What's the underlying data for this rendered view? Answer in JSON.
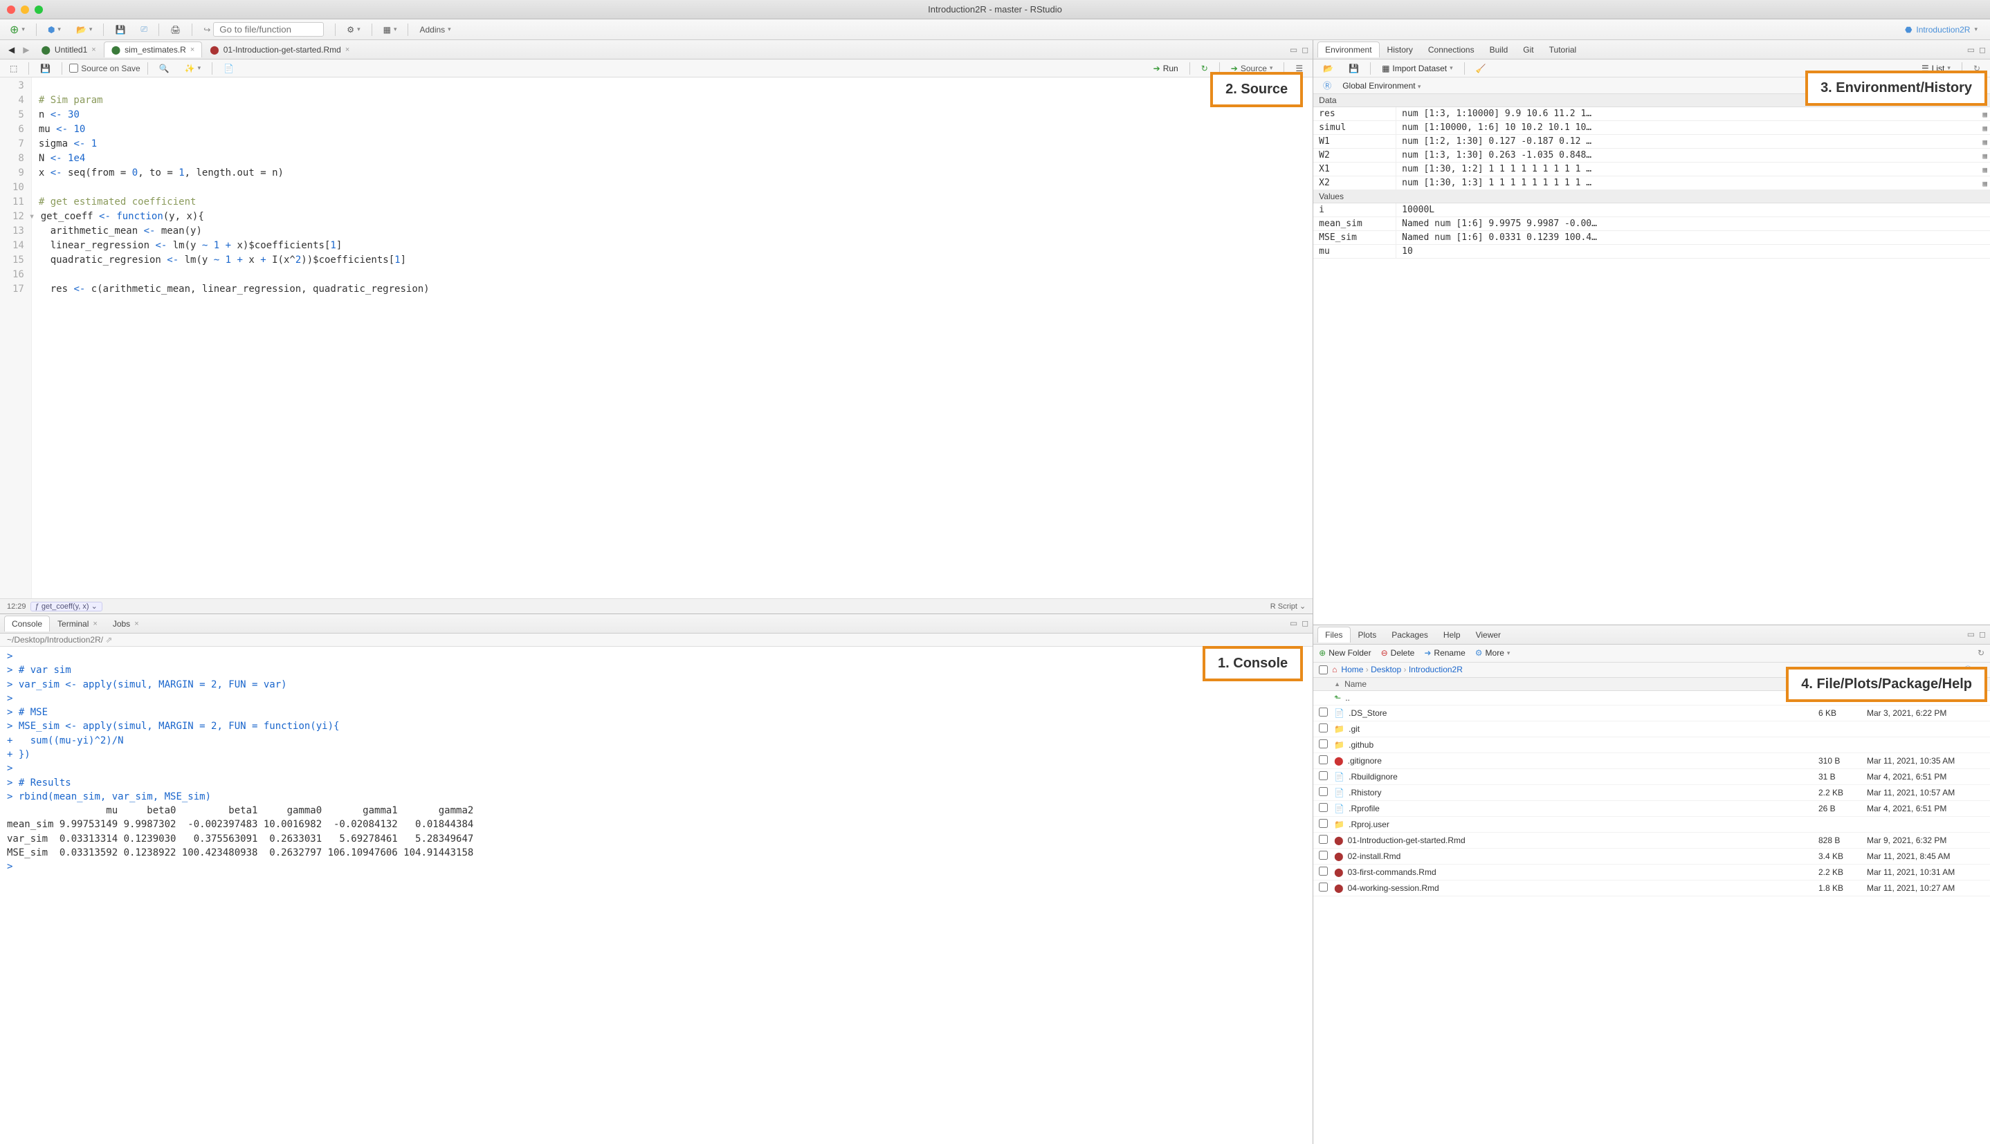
{
  "window": {
    "title": "Introduction2R - master - RStudio"
  },
  "project": {
    "name": "Introduction2R"
  },
  "main_toolbar": {
    "goto_placeholder": "Go to file/function",
    "addins": "Addins"
  },
  "source_pane": {
    "tabs": [
      {
        "label": "Untitled1"
      },
      {
        "label": "sim_estimates.R"
      },
      {
        "label": "01-Introduction-get-started.Rmd"
      }
    ],
    "save_on_source": "Source on Save",
    "run": "Run",
    "source_btn": "Source",
    "gutter_start": 3,
    "code_lines": [
      "",
      "# Sim param",
      "n <- 30",
      "mu <- 10",
      "sigma <- 1",
      "N <- 1e4",
      "x <- seq(from = 0, to = 1, length.out = n)",
      "",
      "# get estimated coefficient",
      "get_coeff <- function(y, x){",
      "  arithmetic_mean <- mean(y)",
      "  linear_regression <- lm(y ~ 1 + x)$coefficients[1]",
      "  quadratic_regresion <- lm(y ~ 1 + x + I(x^2))$coefficients[1]",
      "",
      "  res <- c(arithmetic_mean, linear_regression, quadratic_regresion)"
    ],
    "status": {
      "pos": "12:29",
      "fn": "get_coeff(y, x)",
      "type": "R Script"
    }
  },
  "console_pane": {
    "tabs": [
      "Console",
      "Terminal",
      "Jobs"
    ],
    "path": "~/Desktop/Introduction2R/",
    "lines": [
      {
        "p": ">",
        "t": ""
      },
      {
        "p": ">",
        "t": " # var sim"
      },
      {
        "p": ">",
        "t": " var_sim <- apply(simul, MARGIN = 2, FUN = var)"
      },
      {
        "p": ">",
        "t": ""
      },
      {
        "p": ">",
        "t": " # MSE"
      },
      {
        "p": ">",
        "t": " MSE_sim <- apply(simul, MARGIN = 2, FUN = function(yi){"
      },
      {
        "p": "+",
        "t": "   sum((mu-yi)^2)/N"
      },
      {
        "p": "+",
        "t": " })"
      },
      {
        "p": ">",
        "t": ""
      },
      {
        "p": ">",
        "t": " # Results"
      },
      {
        "p": ">",
        "t": " rbind(mean_sim, var_sim, MSE_sim)"
      }
    ],
    "output_header": "                 mu     beta0         beta1     gamma0       gamma1       gamma2",
    "output_rows": [
      "mean_sim 9.99753149 9.9987302  -0.002397483 10.0016982  -0.02084132   0.01844384",
      "var_sim  0.03313314 0.1239030   0.375563091  0.2633031   5.69278461   5.28349647",
      "MSE_sim  0.03313592 0.1238922 100.423480938  0.2632797 106.10947606 104.91443158"
    ]
  },
  "env_pane": {
    "tabs": [
      "Environment",
      "History",
      "Connections",
      "Build",
      "Git",
      "Tutorial"
    ],
    "import": "Import Dataset",
    "scope": "Global Environment",
    "view": "List",
    "sections": {
      "Data": [
        {
          "n": "res",
          "v": "num [1:3, 1:10000] 9.9 10.6 11.2 1…"
        },
        {
          "n": "simul",
          "v": "num [1:10000, 1:6] 10 10.2 10.1 10…"
        },
        {
          "n": "W1",
          "v": "num [1:2, 1:30] 0.127 -0.187 0.12 …"
        },
        {
          "n": "W2",
          "v": "num [1:3, 1:30] 0.263 -1.035 0.848…"
        },
        {
          "n": "X1",
          "v": "num [1:30, 1:2] 1 1 1 1 1 1 1 1 1 …"
        },
        {
          "n": "X2",
          "v": "num [1:30, 1:3] 1 1 1 1 1 1 1 1 1 …"
        }
      ],
      "Values": [
        {
          "n": "i",
          "v": "10000L"
        },
        {
          "n": "mean_sim",
          "v": "Named num [1:6] 9.9975 9.9987 -0.00…"
        },
        {
          "n": "MSE_sim",
          "v": "Named num [1:6] 0.0331 0.1239 100.4…"
        },
        {
          "n": "mu",
          "v": "10"
        }
      ]
    }
  },
  "files_pane": {
    "tabs": [
      "Files",
      "Plots",
      "Packages",
      "Help",
      "Viewer"
    ],
    "buttons": {
      "new_folder": "New Folder",
      "delete": "Delete",
      "rename": "Rename",
      "more": "More"
    },
    "crumbs": [
      "Home",
      "Desktop",
      "Introduction2R"
    ],
    "header": {
      "name": "Name"
    },
    "rows": [
      {
        "type": "up",
        "name": "..",
        "size": "",
        "date": ""
      },
      {
        "type": "file",
        "name": ".DS_Store",
        "size": "6 KB",
        "date": "Mar 3, 2021, 6:22 PM"
      },
      {
        "type": "folder",
        "name": ".git",
        "size": "",
        "date": ""
      },
      {
        "type": "folder",
        "name": ".github",
        "size": "",
        "date": ""
      },
      {
        "type": "gitignore",
        "name": ".gitignore",
        "size": "310 B",
        "date": "Mar 11, 2021, 10:35 AM"
      },
      {
        "type": "file",
        "name": ".Rbuildignore",
        "size": "31 B",
        "date": "Mar 4, 2021, 6:51 PM"
      },
      {
        "type": "file",
        "name": ".Rhistory",
        "size": "2.2 KB",
        "date": "Mar 11, 2021, 10:57 AM"
      },
      {
        "type": "file",
        "name": ".Rprofile",
        "size": "26 B",
        "date": "Mar 4, 2021, 6:51 PM"
      },
      {
        "type": "folder",
        "name": ".Rproj.user",
        "size": "",
        "date": ""
      },
      {
        "type": "rmd",
        "name": "01-Introduction-get-started.Rmd",
        "size": "828 B",
        "date": "Mar 9, 2021, 6:32 PM"
      },
      {
        "type": "rmd",
        "name": "02-install.Rmd",
        "size": "3.4 KB",
        "date": "Mar 11, 2021, 8:45 AM"
      },
      {
        "type": "rmd",
        "name": "03-first-commands.Rmd",
        "size": "2.2 KB",
        "date": "Mar 11, 2021, 10:31 AM"
      },
      {
        "type": "rmd",
        "name": "04-working-session.Rmd",
        "size": "1.8 KB",
        "date": "Mar 11, 2021, 10:27 AM"
      }
    ]
  },
  "callouts": {
    "source": "2. Source",
    "console": "1. Console",
    "env": "3. Environment/History",
    "files": "4. File/Plots/Package/Help"
  }
}
